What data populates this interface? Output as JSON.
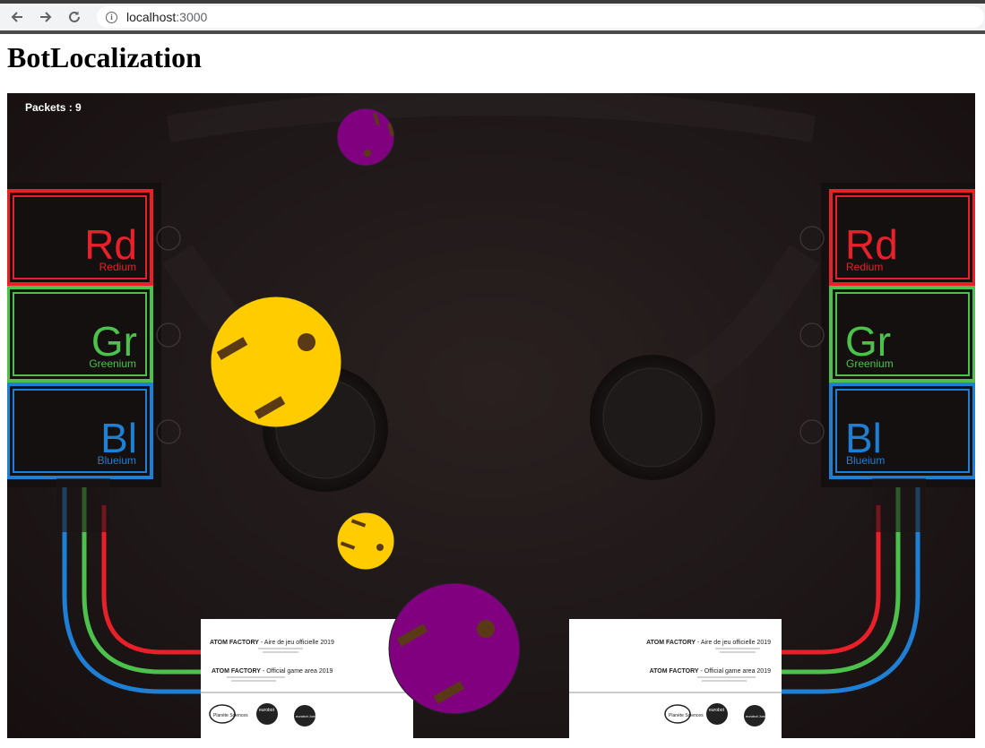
{
  "browser": {
    "url_host": "localhost",
    "url_port": ":3000",
    "icons": [
      "back-arrow-icon",
      "forward-arrow-icon",
      "reload-icon",
      "info-icon"
    ]
  },
  "page": {
    "title": "BotLocalization"
  },
  "game": {
    "packets_label": "Packets : 9",
    "elements": {
      "red": {
        "symbol": "Rd",
        "name": "Redium",
        "color": "#e8202a"
      },
      "green": {
        "symbol": "Gr",
        "name": "Greenium",
        "color": "#4cc24c"
      },
      "blue": {
        "symbol": "Bl",
        "name": "Blueium",
        "color": "#1e7fd6"
      }
    },
    "robot_colors": {
      "yellow": "#ffcc00",
      "purple": "#800080",
      "marker": "#5a3a16"
    },
    "panel": {
      "line1_title": "ATOM FACTORY",
      "line1_text": "- Aire de jeu officielle 2019",
      "line2_title": "ATOM FACTORY",
      "line2_text": "- Official game area 2019",
      "logos": [
        "Planète Sciences",
        "eurobot",
        "eurobot Junior"
      ]
    }
  }
}
